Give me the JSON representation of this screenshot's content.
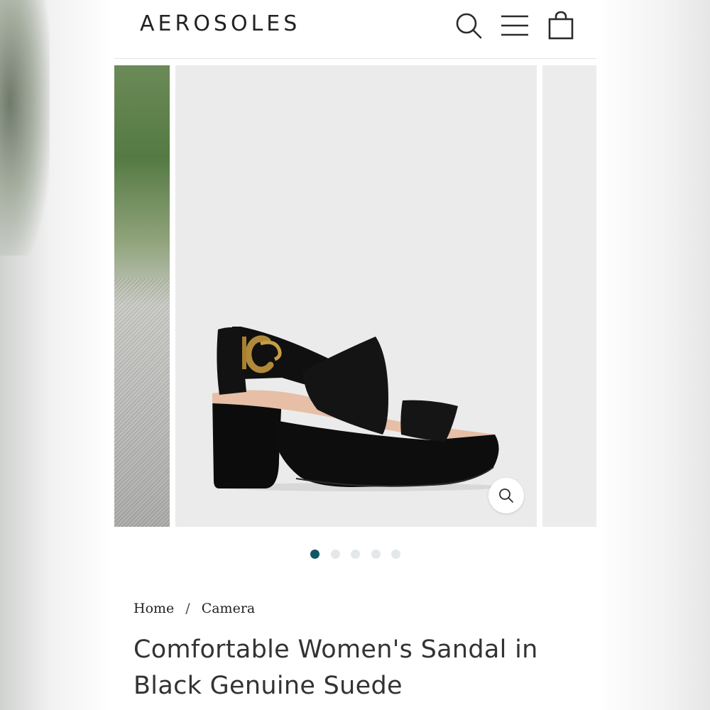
{
  "header": {
    "logo": "AEROSOLES",
    "icons": [
      "search-icon",
      "menu-icon",
      "cart-icon"
    ]
  },
  "carousel": {
    "slide_count": 5,
    "active_index": 0,
    "product_image": "black suede platform sandal with gold buckle",
    "zoom_icon": "zoom-icon"
  },
  "breadcrumb": {
    "home": "Home",
    "separator": "/",
    "current": "Camera"
  },
  "product": {
    "title": "Comfortable Women's Sandal in Black Genuine Suede"
  },
  "colors": {
    "accent": "#0f5667",
    "dot_inactive": "#e4e8ea",
    "text": "#333333",
    "image_bg": "#ebebeb"
  }
}
